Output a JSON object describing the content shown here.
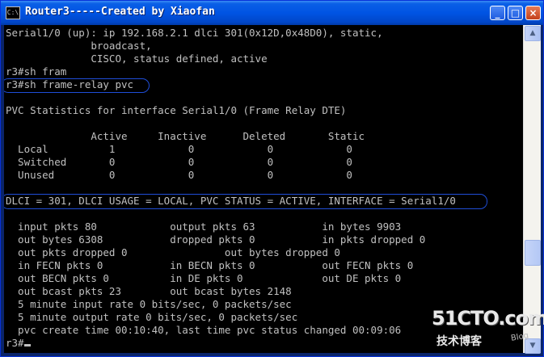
{
  "window": {
    "title": "Router3-----Created by Xiaofan",
    "icon": "command-prompt-icon",
    "buttons": {
      "minimize": "_",
      "maximize": "□",
      "close": "×"
    }
  },
  "console": {
    "lines": [
      "Serial1/0 (up): ip 192.168.2.1 dlci 301(0x12D,0x48D0), static,",
      "              broadcast,",
      "              CISCO, status defined, active",
      "r3#sh fram",
      "r3#sh frame-relay pvc",
      "",
      "PVC Statistics for interface Serial1/0 (Frame Relay DTE)",
      "",
      "              Active     Inactive      Deleted       Static",
      "  Local          1            0            0            0",
      "  Switched       0            0            0            0",
      "  Unused         0            0            0            0",
      "",
      "DLCI = 301, DLCI USAGE = LOCAL, PVC STATUS = ACTIVE, INTERFACE = Serial1/0",
      "",
      "  input pkts 80            output pkts 63           in bytes 9903",
      "  out bytes 6308           dropped pkts 0           in pkts dropped 0",
      "  out pkts dropped 0                out bytes dropped 0",
      "  in FECN pkts 0           in BECN pkts 0           out FECN pkts 0",
      "  out BECN pkts 0          in DE pkts 0             out DE pkts 0",
      "  out bcast pkts 23        out bcast bytes 2148",
      "  5 minute input rate 0 bits/sec, 0 packets/sec",
      "  5 minute output rate 0 bits/sec, 0 packets/sec",
      "  pvc create time 00:10:40, last time pvc status changed 00:09:06",
      "r3#"
    ],
    "highlight_color": "#1f4ed8"
  },
  "scrollbar": {
    "up_arrow": "▲",
    "down_arrow": "▼"
  },
  "watermark": {
    "site": "51CTO.com",
    "tagline": "技术博客",
    "blog": "Blog"
  }
}
